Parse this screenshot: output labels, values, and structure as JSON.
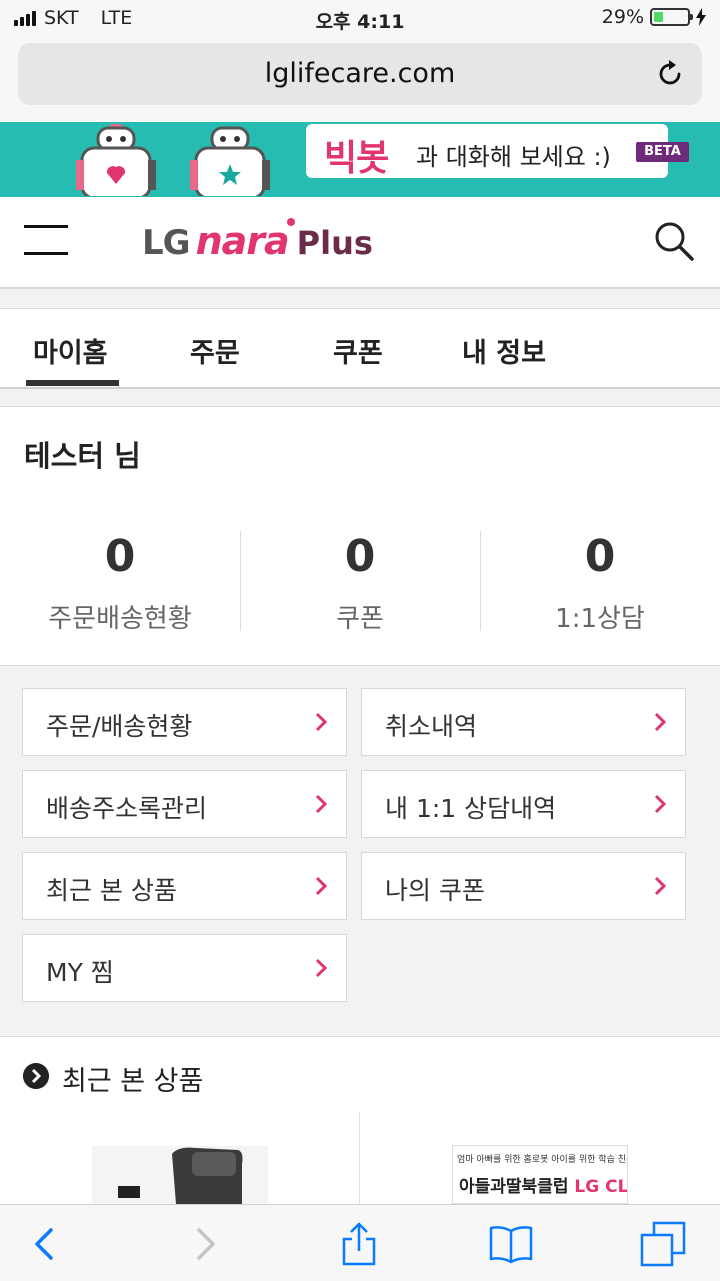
{
  "status_bar": {
    "carrier": "SKT",
    "network": "LTE",
    "time": "오후 4:11",
    "battery_percent": "29%",
    "battery_level": 0.29,
    "battery_color": "#4cd964"
  },
  "browser": {
    "url": "lglifecare.com",
    "reload_icon": "reload-icon"
  },
  "banner": {
    "highlight": "빅봇",
    "text": "과 대화해 보세요 :)",
    "badge": "BETA",
    "background": "#26bcb2"
  },
  "header": {
    "logo_lg": "LG",
    "logo_nara": "nara",
    "logo_plus": "Plus",
    "menu_icon": "hamburger-icon",
    "search_icon": "search-icon",
    "brand_color": "#e0356f"
  },
  "tabs": [
    {
      "label": "마이홈",
      "active": true
    },
    {
      "label": "주문",
      "active": false
    },
    {
      "label": "쿠폰",
      "active": false
    },
    {
      "label": "내 정보",
      "active": false
    }
  ],
  "user": {
    "greeting": "테스터 님"
  },
  "stats": [
    {
      "value": "0",
      "label": "주문배송현황"
    },
    {
      "value": "0",
      "label": "쿠폰"
    },
    {
      "value": "0",
      "label": "1:1상담"
    }
  ],
  "menu": [
    {
      "label": "주문/배송현황"
    },
    {
      "label": "취소내역"
    },
    {
      "label": "배송주소록관리"
    },
    {
      "label": "내 1:1 상담내역"
    },
    {
      "label": "최근 본 상품"
    },
    {
      "label": "나의 쿠폰"
    },
    {
      "label": "MY 찜"
    }
  ],
  "recent": {
    "title": "최근 본 상품",
    "ad_line1": "엄마 아빠를 위한 홈로봇 아이를 위한 학습 친구 반려봇",
    "ad_line2": "아들과딸북클럽",
    "ad_brand": "LG CLOi"
  },
  "toolbar": {
    "back_icon": "back-icon",
    "forward_icon": "forward-icon",
    "share_icon": "share-icon",
    "bookmarks_icon": "bookmarks-icon",
    "tabs_icon": "tabs-icon"
  }
}
